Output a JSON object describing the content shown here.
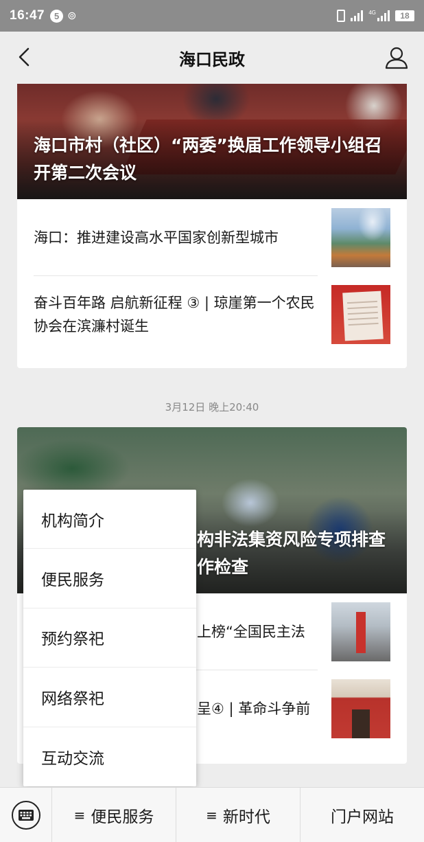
{
  "status_bar": {
    "time": "16:47",
    "badge": "5",
    "network_tag": "4G",
    "battery": "18"
  },
  "nav": {
    "title": "海口民政"
  },
  "card1": {
    "cover_title": "海口市村（社区）“两委”换届工作领导小组召开第二次会议",
    "items": [
      {
        "text": "海口：推进建设高水平国家创新型城市",
        "thumb_icon": "city-photo"
      },
      {
        "text": "奋斗百年路 启航新征程 ③ | 琼崖第一个农民协会在滨濂村诞生",
        "thumb_icon": "document-photo"
      }
    ]
  },
  "timestamp": "3月12日 晚上20:40",
  "card2": {
    "cover_title": "构非法集资风险专项排查 作检查",
    "items": [
      {
        "text": "上榜“全国民主法",
        "thumb_icon": "building-photo"
      },
      {
        "text": "呈④ | 革命斗争前",
        "thumb_icon": "house-photo"
      }
    ]
  },
  "menu": {
    "items": [
      "机构简介",
      "便民服务",
      "预约祭祀",
      "网络祭祀",
      "互动交流"
    ]
  },
  "bottom_bar": {
    "tab_mark": "≡",
    "tabs": [
      "便民服务",
      "新时代",
      "门户网站"
    ]
  }
}
